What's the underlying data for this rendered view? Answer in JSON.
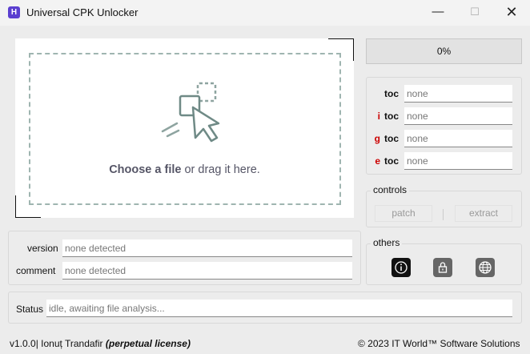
{
  "window": {
    "title": "Universal CPK Unlocker",
    "icon_glyph": "H",
    "minimize": "—",
    "maximize": "☐",
    "close": "✕"
  },
  "dropzone": {
    "choose_text": "Choose a file",
    "drag_text": "or drag it here."
  },
  "progress": {
    "value": 0,
    "label": "0%"
  },
  "toc": {
    "rows": [
      {
        "prefix": "",
        "label": "toc",
        "value": "none"
      },
      {
        "prefix": "i",
        "label": "toc",
        "value": "none"
      },
      {
        "prefix": "g",
        "label": "toc",
        "value": "none"
      },
      {
        "prefix": "e",
        "label": "toc",
        "value": "none"
      }
    ]
  },
  "controls": {
    "title": "controls",
    "patch_label": "patch",
    "extract_label": "extract"
  },
  "others": {
    "title": "others",
    "icons": [
      "info-icon",
      "lock-icon",
      "globe-icon"
    ]
  },
  "info": {
    "version_label": "version",
    "version_value": "none detected",
    "comment_label": "comment",
    "comment_value": "none detected"
  },
  "status": {
    "label": "Status",
    "value": "idle, awaiting file analysis..."
  },
  "footer": {
    "version": "v1.0.0",
    "separator": "|",
    "author": "Ionuț Trandafir",
    "license": "(perpetual license)",
    "copyright": "© 2023 IT World™ Software Solutions"
  },
  "colors": {
    "accent_red": "#cc0000",
    "app_icon": "#5b3fd0",
    "dashed_border": "#9fb5b0"
  }
}
